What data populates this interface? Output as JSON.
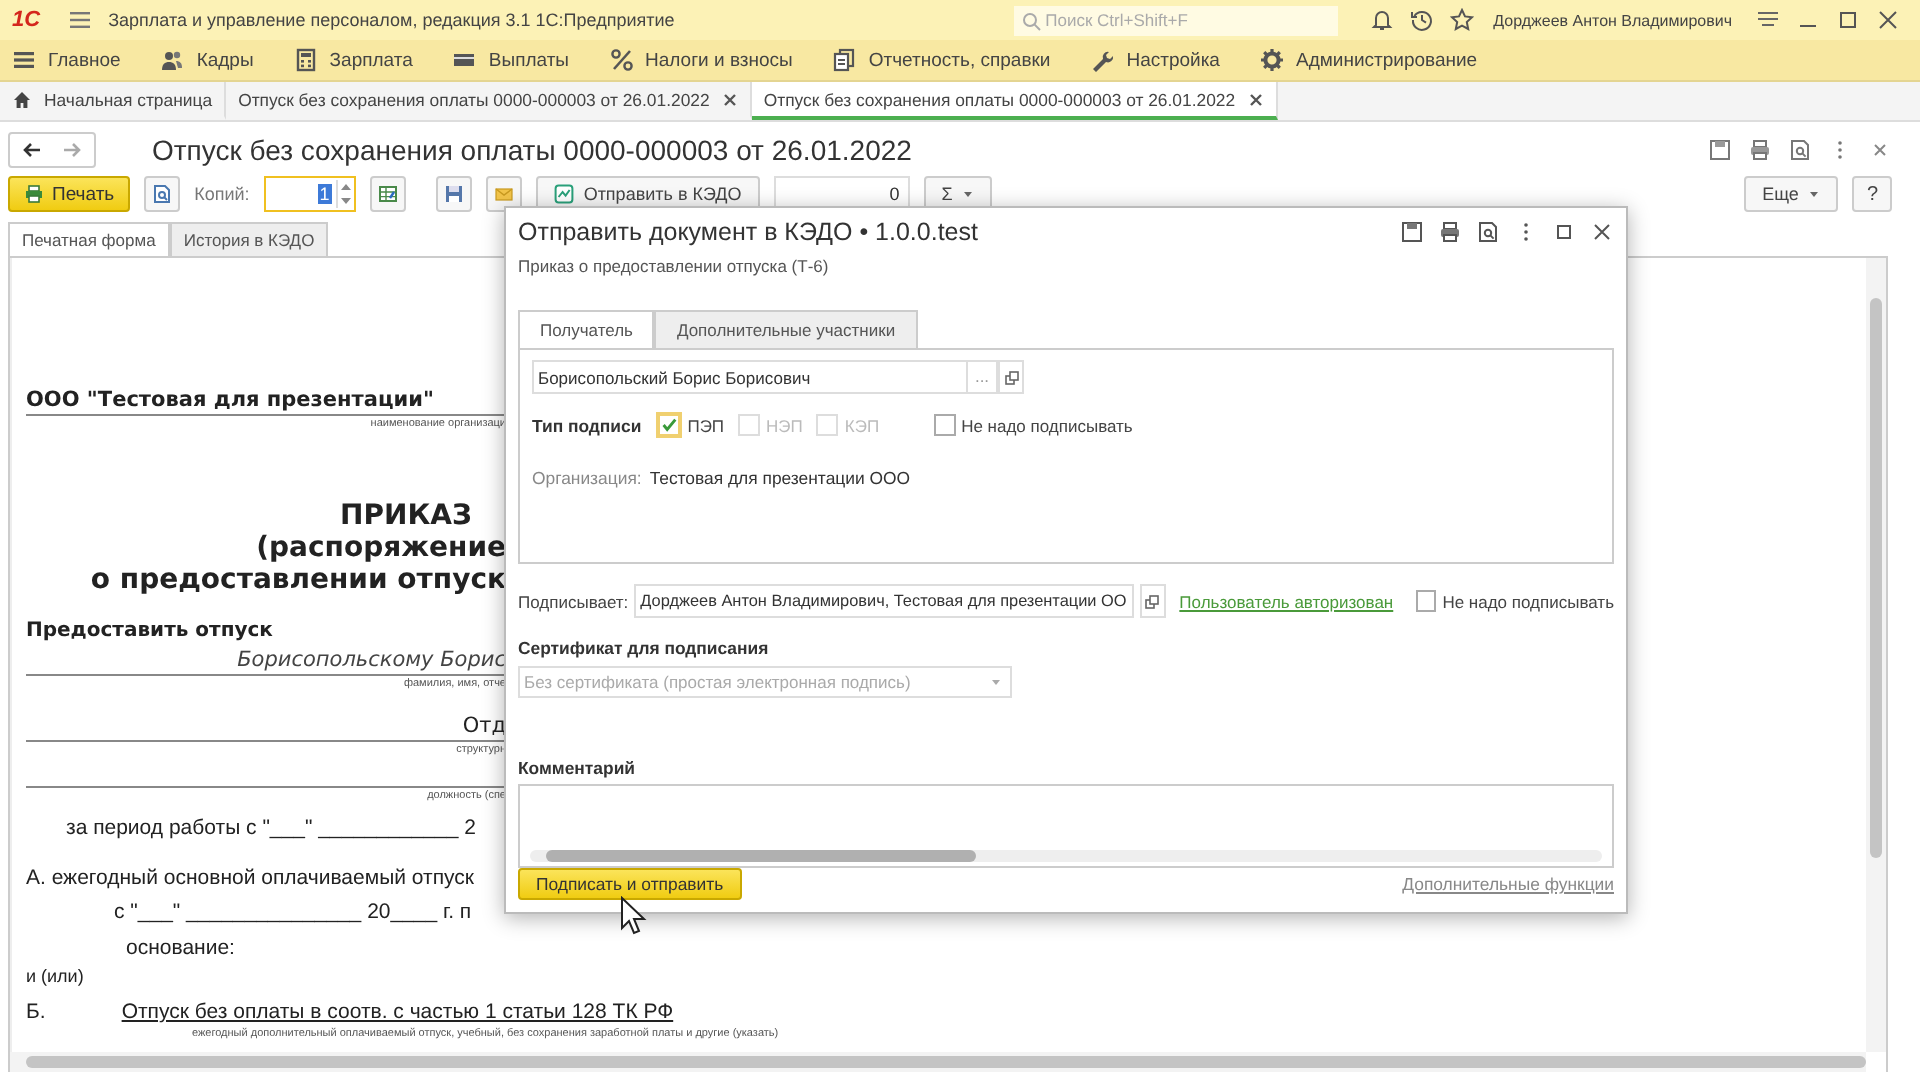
{
  "app": {
    "logo": "1С",
    "title": "Зарплата и управление персоналом, редакция 3.1 1С:Предприятие",
    "search": {
      "placeholder": "Поиск Ctrl+Shift+F"
    },
    "user": "Дорджеев Антон Владимирович"
  },
  "sections": [
    {
      "label": "Главное"
    },
    {
      "label": "Кадры"
    },
    {
      "label": "Зарплата"
    },
    {
      "label": "Выплаты"
    },
    {
      "label": "Налоги и взносы"
    },
    {
      "label": "Отчетность, справки"
    },
    {
      "label": "Настройка"
    },
    {
      "label": "Администрирование"
    }
  ],
  "open_tabs": [
    {
      "label": "Начальная страница",
      "kind": "home",
      "selected": false
    },
    {
      "label": "Отпуск без сохранения оплаты 0000-000003 от 26.01.2022",
      "kind": "doc",
      "selected": false
    },
    {
      "label": "Отпуск без сохранения оплаты 0000-000003 от 26.01.2022",
      "kind": "doc",
      "selected": true
    }
  ],
  "document": {
    "title": "Отпуск без сохранения оплаты 0000-000003 от 26.01.2022",
    "toolbar": {
      "print": "Печать",
      "copies_label": "Копий:",
      "copies": "1",
      "send": "Отправить в КЭДО",
      "amount": "0",
      "sum": "Σ",
      "more": "Еще",
      "help": "?"
    },
    "tabs": [
      {
        "label": "Печатная форма",
        "selected": true
      },
      {
        "label": "История в КЭДО",
        "selected": false
      }
    ],
    "lines": [
      {
        "kind": "org",
        "text": "ООО \"Тестовая для презентации\""
      },
      {
        "kind": "caption",
        "text": "наименование организаци"
      },
      {
        "kind": "title",
        "text": "ПРИКАЗ"
      },
      {
        "kind": "heading",
        "text": "(распоряжение"
      },
      {
        "kind": "heading",
        "text": "о предоставлении отпуск"
      },
      {
        "kind": "section",
        "text": "Предоставить отпуск"
      },
      {
        "kind": "value",
        "text": "Борисопольскому Борис"
      },
      {
        "kind": "caption",
        "text": "фамилия, имя, отче"
      },
      {
        "kind": "plain",
        "text": "Отд"
      },
      {
        "kind": "caption",
        "text": "структурн"
      },
      {
        "kind": "ruled",
        "text": "должность (спе"
      },
      {
        "kind": "period",
        "text": "за период работы с \"___\" ____________ 2"
      },
      {
        "kind": "text",
        "text": "А. ежегодный основной оплачиваемый отпуск"
      },
      {
        "kind": "dates",
        "text": "с  \"___\"  _______________ 20____  г.    п"
      },
      {
        "kind": "basis",
        "text": "основание:"
      },
      {
        "kind": "small",
        "text": "и (или)"
      },
      {
        "kind": "item",
        "prefix": "Б.",
        "text": "Отпуск без оплаты в соотв. с частью 1 статьи 128 ТК РФ"
      },
      {
        "kind": "wide",
        "text": "ежегодный дополнительный оплачиваемый отпуск, учебный, без сохранения заработной платы и другие (указать)"
      }
    ]
  },
  "dialog": {
    "title": "Отправить документ в КЭДО • 1.0.0.test",
    "subtitle": "Приказ о предоставлении отпуска (Т-6)",
    "tabs": [
      {
        "label": "Получатель",
        "selected": true
      },
      {
        "label": "Дополнительные участники",
        "selected": false
      }
    ],
    "recipient": "Борисопольский Борис Борисович",
    "recipient_choose": "...",
    "signature_label": "Тип подписи",
    "signature_types": [
      {
        "label": "ПЭП",
        "checked": true,
        "disabled": false
      },
      {
        "label": "НЭП",
        "checked": false,
        "disabled": true
      },
      {
        "label": "КЭП",
        "checked": false,
        "disabled": true
      }
    ],
    "recipient_no_sign": {
      "label": "Не надо подписывать",
      "checked": false
    },
    "organization_label": "Организация:",
    "organization": "Тестовая для презентации ООО",
    "signer_label": "Подписывает:",
    "signer": "Дорджеев Антон Владимирович, Тестовая для презентации ОО",
    "signer_status": "Пользователь авторизован",
    "signer_no_sign": {
      "label": "Не надо подписывать",
      "checked": false
    },
    "certificate_label": "Сертификат для подписания",
    "certificate": {
      "value": "Без сертификата (простая электронная подпись)",
      "disabled": true
    },
    "comment_label": "Комментарий",
    "submit": "Подписать и отправить",
    "more_functions": "Дополнительные функции"
  }
}
